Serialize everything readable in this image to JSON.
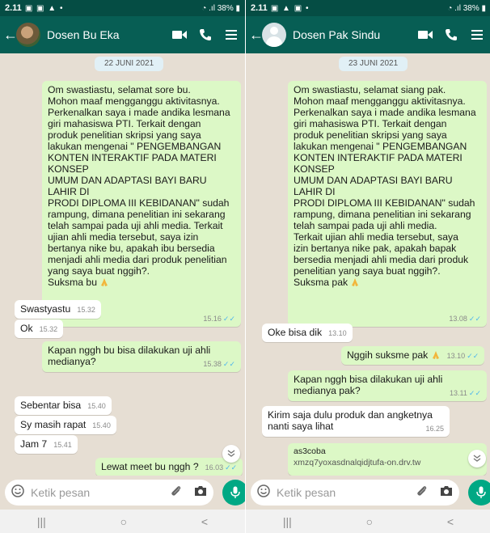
{
  "left": {
    "status": {
      "time": "2.11",
      "indicators": "▣ ▣ ▲ •",
      "right": "38%"
    },
    "header": {
      "contact_name": "Dosen Bu Eka"
    },
    "date_chip": "22 JUNI 2021",
    "messages": [
      {
        "side": "out",
        "text": "Om swastiastu, selamat sore bu.\nMohon maaf mengganggu aktivitasnya.\nPerkenalkan saya i made andika lesmana\ngiri  mahasiswa PTI. Terkait dengan\nproduk penelitian skripsi yang  saya\nlakukan mengenai \" PENGEMBANGAN\nKONTEN INTERAKTIF PADA MATERI\nKONSEP\nUMUM DAN ADAPTASI BAYI BARU\nLAHIR DI\nPRODI DIPLOMA III KEBIDANAN\" sudah\nrampung, dimana penelitian ini sekarang\ntelah sampai pada uji  ahli media. Terkait\nujian ahli media tersebut, saya izin\nbertanya nike bu, apakah ibu bersedia\nmenjadi ahli media dari produk penelitian\nyang saya buat nggih?.",
        "last_line": "Suksma bu",
        "time": "15.16"
      },
      {
        "side": "in",
        "text": "Swastyastu",
        "time": "15.32"
      },
      {
        "side": "in",
        "text": "Ok",
        "time": "15.32"
      },
      {
        "side": "out",
        "text": "Kapan nggh bu bisa dilakukan uji ahli\nmedianya?",
        "time": "15.38"
      },
      {
        "side": "in",
        "text": "Sebentar bisa",
        "time": "15.40"
      },
      {
        "side": "in",
        "text": "Sy masih rapat",
        "time": "15.40"
      },
      {
        "side": "in",
        "text": "Jam 7",
        "time": "15.41"
      },
      {
        "side": "out",
        "text": "Lewat meet bu nggh ?",
        "time": "16.03"
      }
    ],
    "input": {
      "placeholder": "Ketik pesan"
    }
  },
  "right": {
    "status": {
      "time": "2.11",
      "indicators": "▣ ▲ ▣ •",
      "right": "38%"
    },
    "header": {
      "contact_name": "Dosen Pak Sindu"
    },
    "date_chip": "23 JUNI 2021",
    "messages": [
      {
        "side": "out",
        "text": "Om swastiastu, selamat siang pak.\nMohon maaf mengganggu aktivitasnya.\nPerkenalkan saya i made andika lesmana\ngiri  mahasiswa PTI. Terkait dengan\nproduk penelitian skripsi yang  saya\nlakukan mengenai \" PENGEMBANGAN\nKONTEN INTERAKTIF PADA MATERI\nKONSEP\nUMUM DAN ADAPTASI BAYI BARU\nLAHIR DI\nPRODI DIPLOMA III KEBIDANAN\" sudah\nrampung, dimana penelitian ini sekarang\ntelah sampai pada uji  ahli media.\nTerkait ujian ahli media tersebut, saya\nizin bertanya nike pak, apakah bapak\nbersedia menjadi ahli media dari produk\npenelitian yang saya buat nggih?.",
        "last_line": "Suksma pak",
        "time": "13.08"
      },
      {
        "side": "in",
        "text": "Oke bisa dik",
        "time": "13.10"
      },
      {
        "side": "out",
        "text": "Nggih suksme pak",
        "time": "13.10"
      },
      {
        "side": "out",
        "text": "Kapan nggh  bisa dilakukan uji ahli\nmedianya pak?",
        "time": "13.11"
      },
      {
        "side": "in",
        "text": "Kirim saja dulu produk dan angketnya\nnanti saya lihat",
        "time": "16.25"
      },
      {
        "side": "out",
        "link_title": "as3coba",
        "link_url": "xmzq7yoxasdnalqidjtufa-on.drv.tw"
      }
    ],
    "input": {
      "placeholder": "Ketik pesan"
    }
  },
  "nav": {
    "recents": "|||",
    "home": "○",
    "back": "<"
  },
  "colors": {
    "header": "#075e54",
    "statusbar": "#054d44",
    "chat_bg": "#e6ded3",
    "outgoing": "#dcf8c6",
    "incoming": "#ffffff",
    "mic": "#00a884",
    "ticks": "#4fb6ec"
  }
}
